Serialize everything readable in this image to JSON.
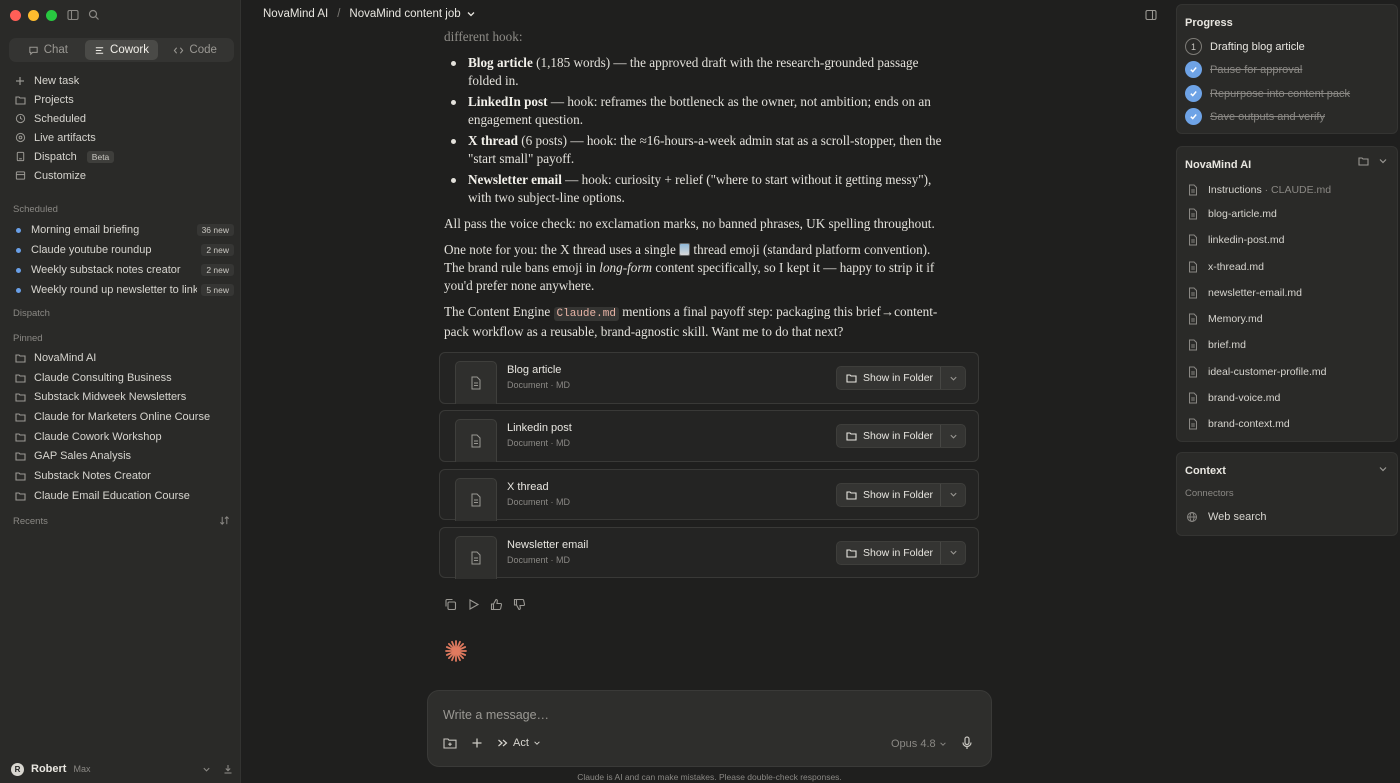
{
  "window": {
    "title": "NovaMind content job"
  },
  "sidebar": {
    "modes": [
      {
        "label": "Chat",
        "icon": "chat-bubble-icon",
        "active": false
      },
      {
        "label": "Cowork",
        "icon": "cowork-icon",
        "active": true
      },
      {
        "label": "Code",
        "icon": "code-icon",
        "active": false
      }
    ],
    "nav": [
      {
        "label": "New task",
        "icon": "plus-icon"
      },
      {
        "label": "Projects",
        "icon": "folder-icon"
      },
      {
        "label": "Scheduled",
        "icon": "clock-icon"
      },
      {
        "label": "Live artifacts",
        "icon": "live-icon"
      },
      {
        "label": "Dispatch",
        "icon": "dispatch-icon",
        "badge": "Beta"
      },
      {
        "label": "Customize",
        "icon": "customize-icon"
      }
    ],
    "scheduled_label": "Scheduled",
    "scheduled": [
      {
        "label": "Morning email briefing",
        "badge": "36 new"
      },
      {
        "label": "Claude youtube roundup",
        "badge": "2 new"
      },
      {
        "label": "Weekly substack notes creator",
        "badge": "2 new"
      },
      {
        "label": "Weekly round up newsletter to linkedin",
        "badge": "5 new"
      }
    ],
    "dispatch_label": "Dispatch",
    "pinned_label": "Pinned",
    "pinned": [
      "NovaMind AI",
      "Claude Consulting Business",
      "Substack Midweek Newsletters",
      "Claude for Marketers Online Course",
      "Claude Cowork Workshop",
      "GAP Sales Analysis",
      "Substack Notes Creator",
      "Claude Email Education Course"
    ],
    "recents_label": "Recents",
    "user": {
      "initial": "R",
      "name": "Robert",
      "plan": "Max"
    }
  },
  "header": {
    "project": "NovaMind AI",
    "separator": "/",
    "job": "NovaMind content job"
  },
  "message": {
    "intro": "different hook:",
    "bullets": [
      {
        "title": "Blog article",
        "text": " (1,185 words) — the approved draft with the research-grounded passage folded in."
      },
      {
        "title": "LinkedIn post",
        "text": " — hook: reframes the bottleneck as the owner, not ambition; ends on an engagement question."
      },
      {
        "title": "X thread",
        "text": " (6 posts) — hook: the ≈16-hours-a-week admin stat as a scroll-stopper, then the \"start small\" payoff."
      },
      {
        "title": "Newsletter email",
        "text": " — hook: curiosity + relief (\"where to start without it getting messy\"), with two subject-line options."
      }
    ],
    "voice_check": "All pass the voice check: no exclamation marks, no banned phrases, UK spelling throughout.",
    "note_a": "One note for you: the X thread uses a single ",
    "note_b": " thread emoji (standard platform convention). The brand rule bans emoji in ",
    "note_em": "long-form",
    "note_c": " content specifically, so I kept it — happy to strip it if you'd prefer none anywhere.",
    "engine_a": "The Content Engine ",
    "engine_code": "Claude.md",
    "engine_b": " mentions a final payoff step: packaging this brief→content-pack workflow as a reusable, brand-agnostic skill. Want me to do that next?"
  },
  "files": [
    {
      "name": "Blog article",
      "type": "Document · MD",
      "button": "Show in Folder"
    },
    {
      "name": "Linkedin post",
      "type": "Document · MD",
      "button": "Show in Folder"
    },
    {
      "name": "X thread",
      "type": "Document · MD",
      "button": "Show in Folder"
    },
    {
      "name": "Newsletter email",
      "type": "Document · MD",
      "button": "Show in Folder"
    }
  ],
  "composer": {
    "placeholder": "Write a message…",
    "act": "Act",
    "model": "Opus 4.8",
    "disclaimer": "Claude is AI and can make mistakes. Please double-check responses."
  },
  "progress": {
    "title": "Progress",
    "steps": [
      {
        "label": "Drafting blog article",
        "marker": "1",
        "done": false
      },
      {
        "label": "Pause for approval",
        "done": true
      },
      {
        "label": "Repurpose into content pack",
        "done": true
      },
      {
        "label": "Save outputs and verify",
        "done": true
      }
    ]
  },
  "project_panel": {
    "title": "NovaMind AI",
    "files": [
      {
        "name": "Instructions",
        "sub": " · CLAUDE.md"
      },
      {
        "name": "blog-article.md",
        "sub": ""
      },
      {
        "name": "linkedin-post.md",
        "sub": ""
      },
      {
        "name": "x-thread.md",
        "sub": ""
      },
      {
        "name": "newsletter-email.md",
        "sub": ""
      },
      {
        "name": "Memory.md",
        "sub": ""
      },
      {
        "name": "brief.md",
        "sub": ""
      },
      {
        "name": "ideal-customer-profile.md",
        "sub": ""
      },
      {
        "name": "brand-voice.md",
        "sub": ""
      },
      {
        "name": "brand-context.md",
        "sub": ""
      }
    ]
  },
  "context_panel": {
    "title": "Context",
    "connectors_label": "Connectors",
    "items": [
      {
        "label": "Web search",
        "icon": "globe-icon"
      }
    ]
  },
  "colors": {
    "accent": "#6ea3e6",
    "spark": "#e07a5f",
    "background": "#1f1f1e"
  }
}
